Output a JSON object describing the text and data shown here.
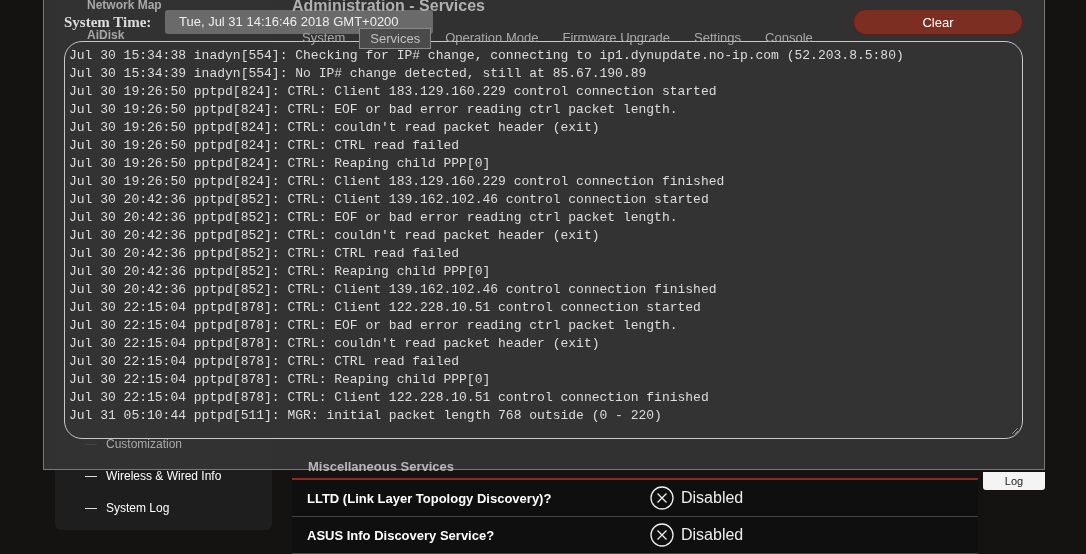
{
  "sidebar": {
    "top_items": [
      {
        "label": "Network Map"
      },
      {
        "label": "AiDisk"
      }
    ],
    "bottom_items": [
      {
        "label": "Customization"
      },
      {
        "label": "Wireless & Wired Info"
      },
      {
        "label": "System Log"
      }
    ]
  },
  "main": {
    "title": "Administration - Services",
    "tabs": [
      {
        "label": "System",
        "selected": false
      },
      {
        "label": "Services",
        "selected": true
      },
      {
        "label": "Operation Mode",
        "selected": false
      },
      {
        "label": "Firmware Upgrade",
        "selected": false
      },
      {
        "label": "Settings",
        "selected": false
      },
      {
        "label": "Console",
        "selected": false
      }
    ],
    "section_title": "Miscellaneous Services",
    "settings": [
      {
        "label": "LLTD (Link Layer Topology Discovery)?",
        "value": "Disabled",
        "enabled": false
      },
      {
        "label": "ASUS Info Discovery Service?",
        "value": "Disabled",
        "enabled": false
      }
    ]
  },
  "log_button": "Log",
  "dialog": {
    "system_time_label": "System Time:",
    "system_time": "Tue, Jul 31 14:16:46 2018 GMT+0200",
    "clear_button": "Clear",
    "log_lines": [
      "Jul 30 15:34:38 inadyn[554]: Checking for IP# change, connecting to ip1.dynupdate.no-ip.com (52.203.8.5:80)",
      "Jul 30 15:34:39 inadyn[554]: No IP# change detected, still at 85.67.190.89",
      "Jul 30 19:26:50 pptpd[824]: CTRL: Client 183.129.160.229 control connection started",
      "Jul 30 19:26:50 pptpd[824]: CTRL: EOF or bad error reading ctrl packet length.",
      "Jul 30 19:26:50 pptpd[824]: CTRL: couldn't read packet header (exit)",
      "Jul 30 19:26:50 pptpd[824]: CTRL: CTRL read failed",
      "Jul 30 19:26:50 pptpd[824]: CTRL: Reaping child PPP[0]",
      "Jul 30 19:26:50 pptpd[824]: CTRL: Client 183.129.160.229 control connection finished",
      "Jul 30 20:42:36 pptpd[852]: CTRL: Client 139.162.102.46 control connection started",
      "Jul 30 20:42:36 pptpd[852]: CTRL: EOF or bad error reading ctrl packet length.",
      "Jul 30 20:42:36 pptpd[852]: CTRL: couldn't read packet header (exit)",
      "Jul 30 20:42:36 pptpd[852]: CTRL: CTRL read failed",
      "Jul 30 20:42:36 pptpd[852]: CTRL: Reaping child PPP[0]",
      "Jul 30 20:42:36 pptpd[852]: CTRL: Client 139.162.102.46 control connection finished",
      "Jul 30 22:15:04 pptpd[878]: CTRL: Client 122.228.10.51 control connection started",
      "Jul 30 22:15:04 pptpd[878]: CTRL: EOF or bad error reading ctrl packet length.",
      "Jul 30 22:15:04 pptpd[878]: CTRL: couldn't read packet header (exit)",
      "Jul 30 22:15:04 pptpd[878]: CTRL: CTRL read failed",
      "Jul 30 22:15:04 pptpd[878]: CTRL: Reaping child PPP[0]",
      "Jul 30 22:15:04 pptpd[878]: CTRL: Client 122.228.10.51 control connection finished",
      "Jul 31 05:10:44 pptpd[511]: MGR: initial packet length 768 outside (0 - 220)"
    ]
  }
}
